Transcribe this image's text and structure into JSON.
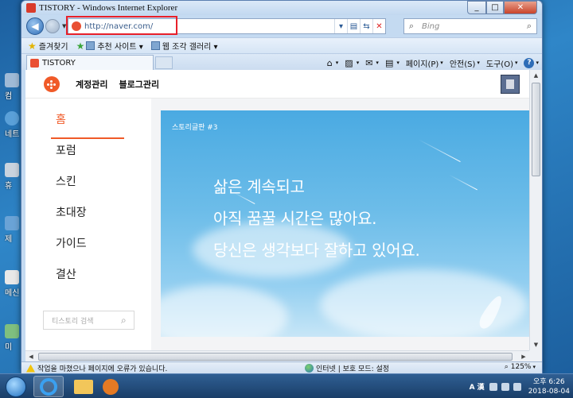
{
  "window": {
    "title": "TISTORY - Windows Internet Explorer"
  },
  "address": {
    "url": "http://naver.com/",
    "search_placeholder": "Bing"
  },
  "favorites": {
    "label": "즐겨찾기",
    "items": [
      "추천 사이트 ▾",
      "웹 조각 갤러리 ▾"
    ]
  },
  "tab": {
    "label": "TISTORY"
  },
  "commandbar": {
    "page": "페이지(P)",
    "safety": "안전(S)",
    "tools": "도구(O)"
  },
  "site": {
    "header_links": [
      "계정관리",
      "블로그관리"
    ],
    "sidebar": [
      "홈",
      "포럼",
      "스킨",
      "초대장",
      "가이드",
      "결산"
    ],
    "search_placeholder": "티스토리 검색",
    "banner": {
      "tag": "스토리글판 #3",
      "lines": [
        "삶은 계속되고",
        "아직 꿈꿀 시간은 많아요.",
        "당신은 생각보다 잘하고 있어요."
      ]
    }
  },
  "status": {
    "message": "작업을 마쳤으나 페이지에 오류가 있습니다.",
    "zone": "인터넷 | 보호 모드: 설정",
    "zoom": "125%"
  },
  "taskbar": {
    "ime": "A 漢",
    "time": "오후 6:26",
    "date": "2018-08-04"
  },
  "desktop_icons": [
    "컴",
    "네트",
    "휴",
    "제",
    "메신",
    "미"
  ]
}
